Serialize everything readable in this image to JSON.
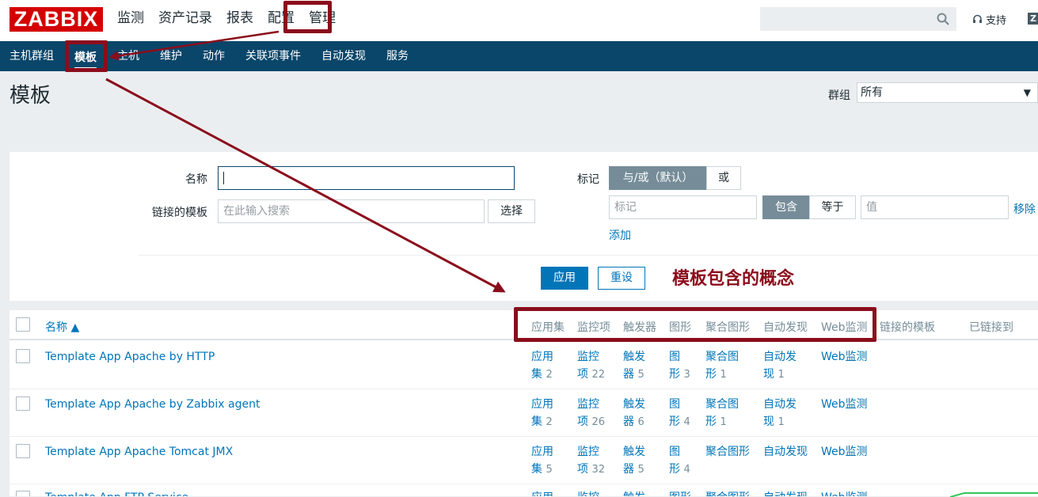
{
  "app": {
    "logo": "ZABBIX",
    "support": "支持",
    "z_icon": "Z"
  },
  "main_menu": [
    "监测",
    "资产记录",
    "报表",
    "配置",
    "管理"
  ],
  "sub_menu": [
    "主机群组",
    "模板",
    "主机",
    "维护",
    "动作",
    "关联项事件",
    "自动发现",
    "服务"
  ],
  "page": {
    "title": "模板",
    "group_label": "群组",
    "group_value": "所有"
  },
  "filter": {
    "name_label": "名称",
    "name_value": "",
    "linked_label": "链接的模板",
    "linked_placeholder": "在此输入搜索",
    "select_button": "选择",
    "tag_label": "标记",
    "andor_label": "与/或（默认）",
    "or_label": "或",
    "tag_placeholder": "标记",
    "contains_label": "包含",
    "equals_label": "等于",
    "value_placeholder": "值",
    "remove_label": "移除",
    "add_label": "添加",
    "apply_button": "应用",
    "reset_button": "重设"
  },
  "annotation": {
    "text": "模板包含的概念"
  },
  "table": {
    "headers": {
      "name": "名称 ▲",
      "apps": "应用集",
      "items": "监控项",
      "triggers": "触发器",
      "graphs": "图形",
      "screens": "聚合图形",
      "discovery": "自动发现",
      "web": "Web监测",
      "linked": "链接的模板",
      "linked_to": "已链接到"
    },
    "rows": [
      {
        "name": "Template App Apache by HTTP",
        "apps_a": "应用",
        "apps_b": "集",
        "apps_n": "2",
        "items_a": "监控",
        "items_b": "项",
        "items_n": "22",
        "trig_a": "触发",
        "trig_b": "器",
        "trig_n": "5",
        "graph_a": "图",
        "graph_b": "形",
        "graph_n": "3",
        "scr_a": "聚合图",
        "scr_b": "形",
        "scr_n": "1",
        "disc_a": "自动发",
        "disc_b": "现",
        "disc_n": "1",
        "web": "Web监测"
      },
      {
        "name": "Template App Apache by Zabbix agent",
        "apps_a": "应用",
        "apps_b": "集",
        "apps_n": "2",
        "items_a": "监控",
        "items_b": "项",
        "items_n": "26",
        "trig_a": "触发",
        "trig_b": "器",
        "trig_n": "6",
        "graph_a": "图",
        "graph_b": "形",
        "graph_n": "4",
        "scr_a": "聚合图",
        "scr_b": "形",
        "scr_n": "1",
        "disc_a": "自动发",
        "disc_b": "现",
        "disc_n": "1",
        "web": "Web监测"
      },
      {
        "name": "Template App Apache Tomcat JMX",
        "apps_a": "应用",
        "apps_b": "集",
        "apps_n": "5",
        "items_a": "监控",
        "items_b": "项",
        "items_n": "32",
        "trig_a": "触发",
        "trig_b": "器",
        "trig_n": "5",
        "graph_a": "图",
        "graph_b": "形",
        "graph_n": "4",
        "scr_a": "聚合图形",
        "disc_a": "自动发现",
        "web": "Web监测"
      },
      {
        "name": "Template App FTP Service",
        "apps_a": "应用",
        "items_a": "监控",
        "trig_a": "触发",
        "graph_a": "图形",
        "scr_a": "聚合图形",
        "disc_a": "自动发现",
        "web": "Web监测"
      }
    ]
  },
  "colors": {
    "brand": "#d40000",
    "nav": "#0a466a",
    "link": "#0275b8",
    "annotation": "#8b0d1c"
  }
}
